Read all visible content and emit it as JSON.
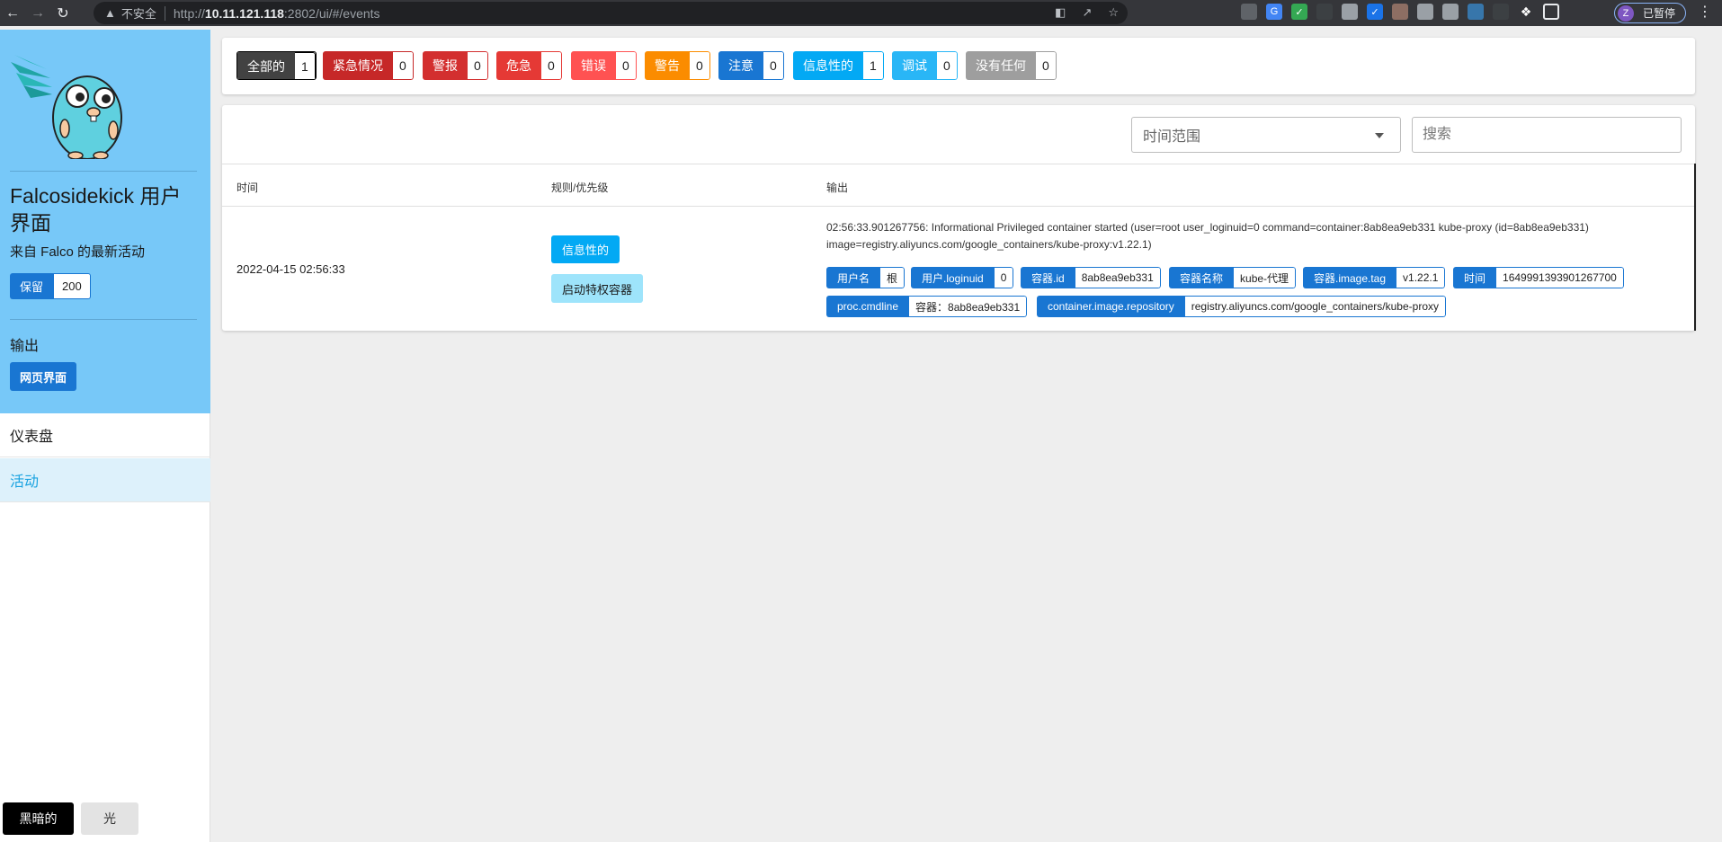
{
  "browser": {
    "insecure_label": "不安全",
    "url_scheme": "http://",
    "url_host": "10.11.121.118",
    "url_rest": ":2802/ui/#/events",
    "profile_initial": "Z",
    "profile_status": "已暂停"
  },
  "sidebar": {
    "title": "Falcosidekick 用户界面",
    "subtitle": "来自 Falco 的最新活动",
    "retain_label": "保留",
    "retain_value": "200",
    "output_label": "输出",
    "web_ui_button": "网页界面",
    "menu": [
      {
        "label": "仪表盘"
      },
      {
        "label": "活动"
      }
    ],
    "theme_dark": "黑暗的",
    "theme_light": "光"
  },
  "filters": [
    {
      "label": "全部的",
      "count": "1",
      "color": "#424242",
      "border": "#000000"
    },
    {
      "label": "紧急情况",
      "count": "0",
      "color": "#c62828",
      "border": "#c62828"
    },
    {
      "label": "警报",
      "count": "0",
      "color": "#d32f2f",
      "border": "#d32f2f"
    },
    {
      "label": "危急",
      "count": "0",
      "color": "#e53935",
      "border": "#e53935"
    },
    {
      "label": "错误",
      "count": "0",
      "color": "#ff5252",
      "border": "#ff5252"
    },
    {
      "label": "警告",
      "count": "0",
      "color": "#fb8c00",
      "border": "#fb8c00"
    },
    {
      "label": "注意",
      "count": "0",
      "color": "#1976d2",
      "border": "#1976d2"
    },
    {
      "label": "信息性的",
      "count": "1",
      "color": "#03a9f4",
      "border": "#03a9f4"
    },
    {
      "label": "调试",
      "count": "0",
      "color": "#29b6f6",
      "border": "#29b6f6"
    },
    {
      "label": "没有任何",
      "count": "0",
      "color": "#9e9e9e",
      "border": "#9e9e9e"
    }
  ],
  "toolbar": {
    "time_range_placeholder": "时间范围",
    "search_placeholder": "搜索"
  },
  "table": {
    "headers": {
      "time": "时间",
      "rule": "规则/优先级",
      "output": "输出"
    },
    "rows": [
      {
        "time": "2022-04-15 02:56:33",
        "priority": "信息性的",
        "rule": "启动特权容器",
        "output": "02:56:33.901267756: Informational Privileged container started (user=root user_loginuid=0 command=container:8ab8ea9eb331 kube-proxy (id=8ab8ea9eb331) image=registry.aliyuncs.com/google_containers/kube-proxy:v1.22.1)",
        "fields": [
          {
            "key": "用户名",
            "value": "根"
          },
          {
            "key": "用户.loginuid",
            "value": "0"
          },
          {
            "key": "容器.id",
            "value": "8ab8ea9eb331"
          },
          {
            "key": "容器名称",
            "value": "kube-代理"
          },
          {
            "key": "容器.image.tag",
            "value": "v1.22.1"
          },
          {
            "key": "时间",
            "value": "1649991393901267700"
          },
          {
            "key": "proc.cmdline",
            "value": "容器：8ab8ea9eb331"
          },
          {
            "key": "container.image.repository",
            "value": "registry.aliyuncs.com/google_containers/kube-proxy"
          }
        ]
      }
    ]
  }
}
